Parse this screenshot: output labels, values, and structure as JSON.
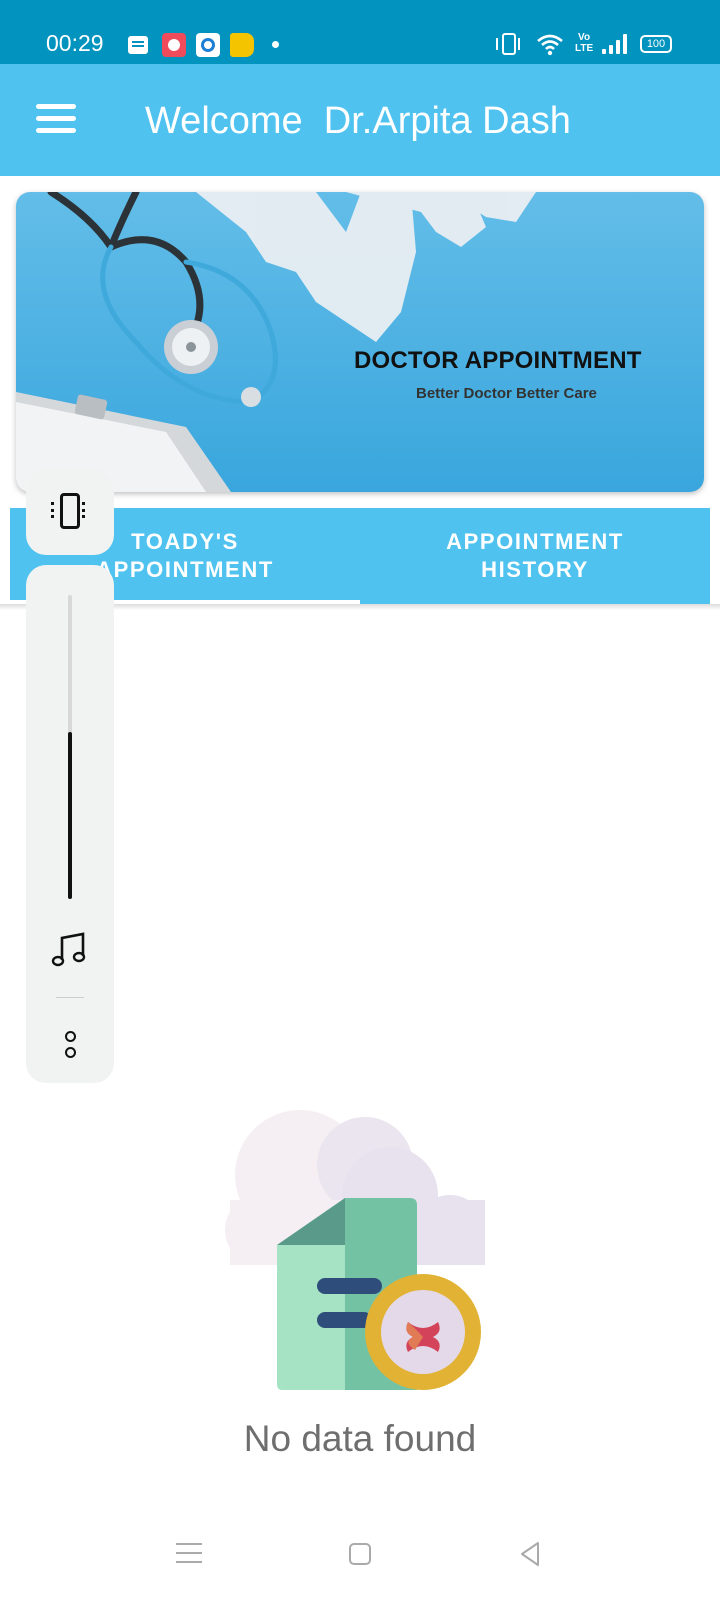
{
  "status_bar": {
    "time": "00:29",
    "volte_label": "Vo\nLTE",
    "battery": "100",
    "icons": [
      "message-notification-icon",
      "red-app-notification-icon",
      "blue-app-notification-icon",
      "yellow-tag-notification-icon",
      "more-notifications-dot-icon",
      "vibrate-mode-icon",
      "wifi-icon",
      "volte-icon",
      "signal-icon",
      "battery-icon"
    ]
  },
  "app_bar": {
    "menu_icon": "hamburger-menu-icon",
    "title": "Welcome  Dr.Arpita Dash",
    "background_color": "#4fc2ef"
  },
  "banner": {
    "title": "DOCTOR APPOINTMENT",
    "subtitle": "Better Doctor Better Care",
    "imagery": [
      "stethoscope",
      "gloves",
      "clipboard"
    ]
  },
  "tabs": {
    "items": [
      {
        "label": "TOADY'S\nAPPOINTMENT",
        "selected": true
      },
      {
        "label": "APPOINTMENT\nHISTORY",
        "selected": false
      }
    ],
    "indicator_color": "#ffffff"
  },
  "volume_overlay": {
    "ringer_mode_icon": "vibrate-icon",
    "level": 0.55,
    "stream_icon": "music-note-icon",
    "more_icon": "more-options-icon"
  },
  "empty_state": {
    "icon": "no-document-cloud-icon",
    "message": "No data found"
  },
  "nav_bar": {
    "icons": [
      "recent-apps-icon",
      "home-icon",
      "back-icon"
    ]
  }
}
